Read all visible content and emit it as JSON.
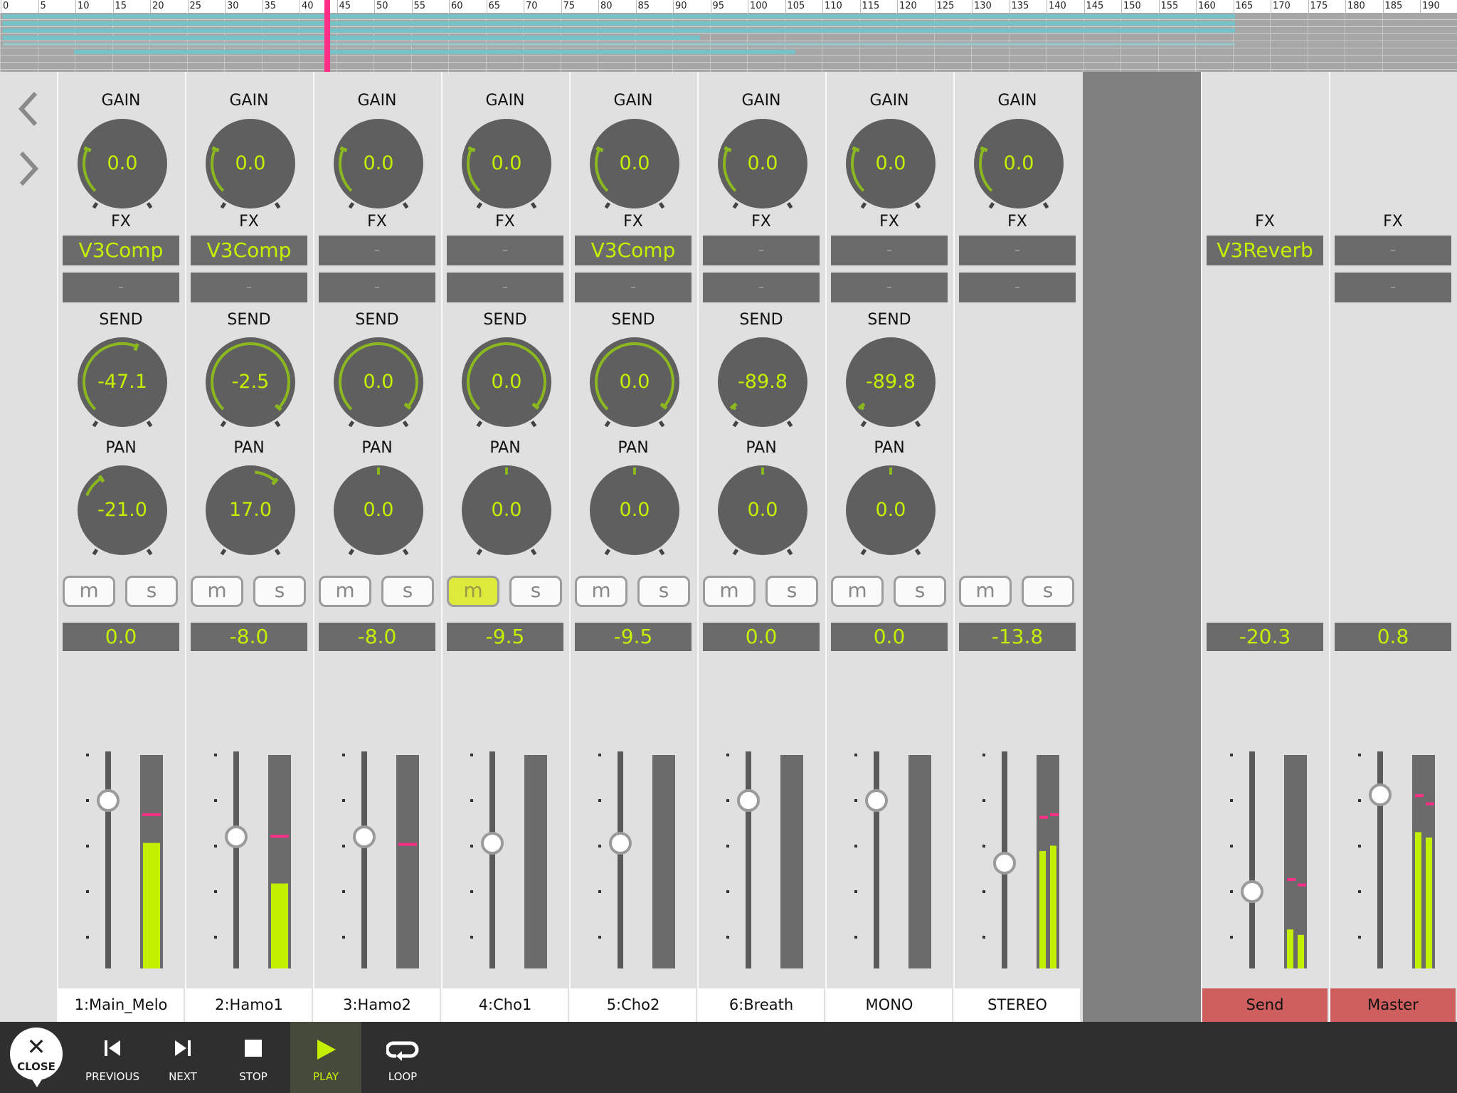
{
  "ruler": [
    "0",
    "5",
    "10",
    "15",
    "20",
    "25",
    "30",
    "35",
    "40",
    "45",
    "50",
    "55",
    "60",
    "65",
    "70",
    "75",
    "80",
    "85",
    "90",
    "95",
    "100",
    "105",
    "110",
    "115",
    "120",
    "125",
    "130",
    "135",
    "140",
    "145",
    "150",
    "155",
    "160",
    "165",
    "170",
    "175",
    "180",
    "185",
    "190"
  ],
  "colors": {
    "accent": "#c3f000",
    "playhead": "#ff2f88",
    "track": "#74c3c9",
    "red_label": "#cf5f5f",
    "peak": "#ff2f88"
  },
  "labels": {
    "gain": "GAIN",
    "fx": "FX",
    "send": "SEND",
    "pan": "PAN",
    "mute": "m",
    "solo": "s"
  },
  "strips": [
    {
      "name": "1:Main_Melo",
      "gain": "0.0",
      "fx1": "V3Comp",
      "fx2": "-",
      "send": "-47.1",
      "pan": "-21.0",
      "mute_on": false,
      "volume": "0.0"
    },
    {
      "name": "2:Hamo1",
      "gain": "0.0",
      "fx1": "V3Comp",
      "fx2": "-",
      "send": "-2.5",
      "pan": "17.0",
      "mute_on": false,
      "volume": "-8.0"
    },
    {
      "name": "3:Hamo2",
      "gain": "0.0",
      "fx1": "-",
      "fx2": "-",
      "send": "0.0",
      "pan": "0.0",
      "mute_on": false,
      "volume": "-8.0"
    },
    {
      "name": "4:Cho1",
      "gain": "0.0",
      "fx1": "-",
      "fx2": "-",
      "send": "0.0",
      "pan": "0.0",
      "mute_on": true,
      "volume": "-9.5"
    },
    {
      "name": "5:Cho2",
      "gain": "0.0",
      "fx1": "V3Comp",
      "fx2": "-",
      "send": "0.0",
      "pan": "0.0",
      "mute_on": false,
      "volume": "-9.5"
    },
    {
      "name": "6:Breath",
      "gain": "0.0",
      "fx1": "-",
      "fx2": "-",
      "send": "-89.8",
      "pan": "0.0",
      "mute_on": false,
      "volume": "0.0"
    },
    {
      "name": "MONO",
      "gain": "0.0",
      "fx1": "-",
      "fx2": "-",
      "send": "-89.8",
      "pan": "0.0",
      "mute_on": false,
      "volume": "0.0"
    },
    {
      "name": "STEREO",
      "gain": "0.0",
      "fx1": "-",
      "fx2": "-",
      "volume": "-13.8"
    }
  ],
  "bus": [
    {
      "name": "Send",
      "fx1": "V3Reverb",
      "volume": "-20.3"
    },
    {
      "name": "Master",
      "fx1": "-",
      "fx2": "-",
      "volume": "0.8"
    }
  ],
  "transport": {
    "close": "CLOSE",
    "previous": "PREVIOUS",
    "next": "NEXT",
    "stop": "STOP",
    "play": "PLAY",
    "loop": "LOOP"
  }
}
